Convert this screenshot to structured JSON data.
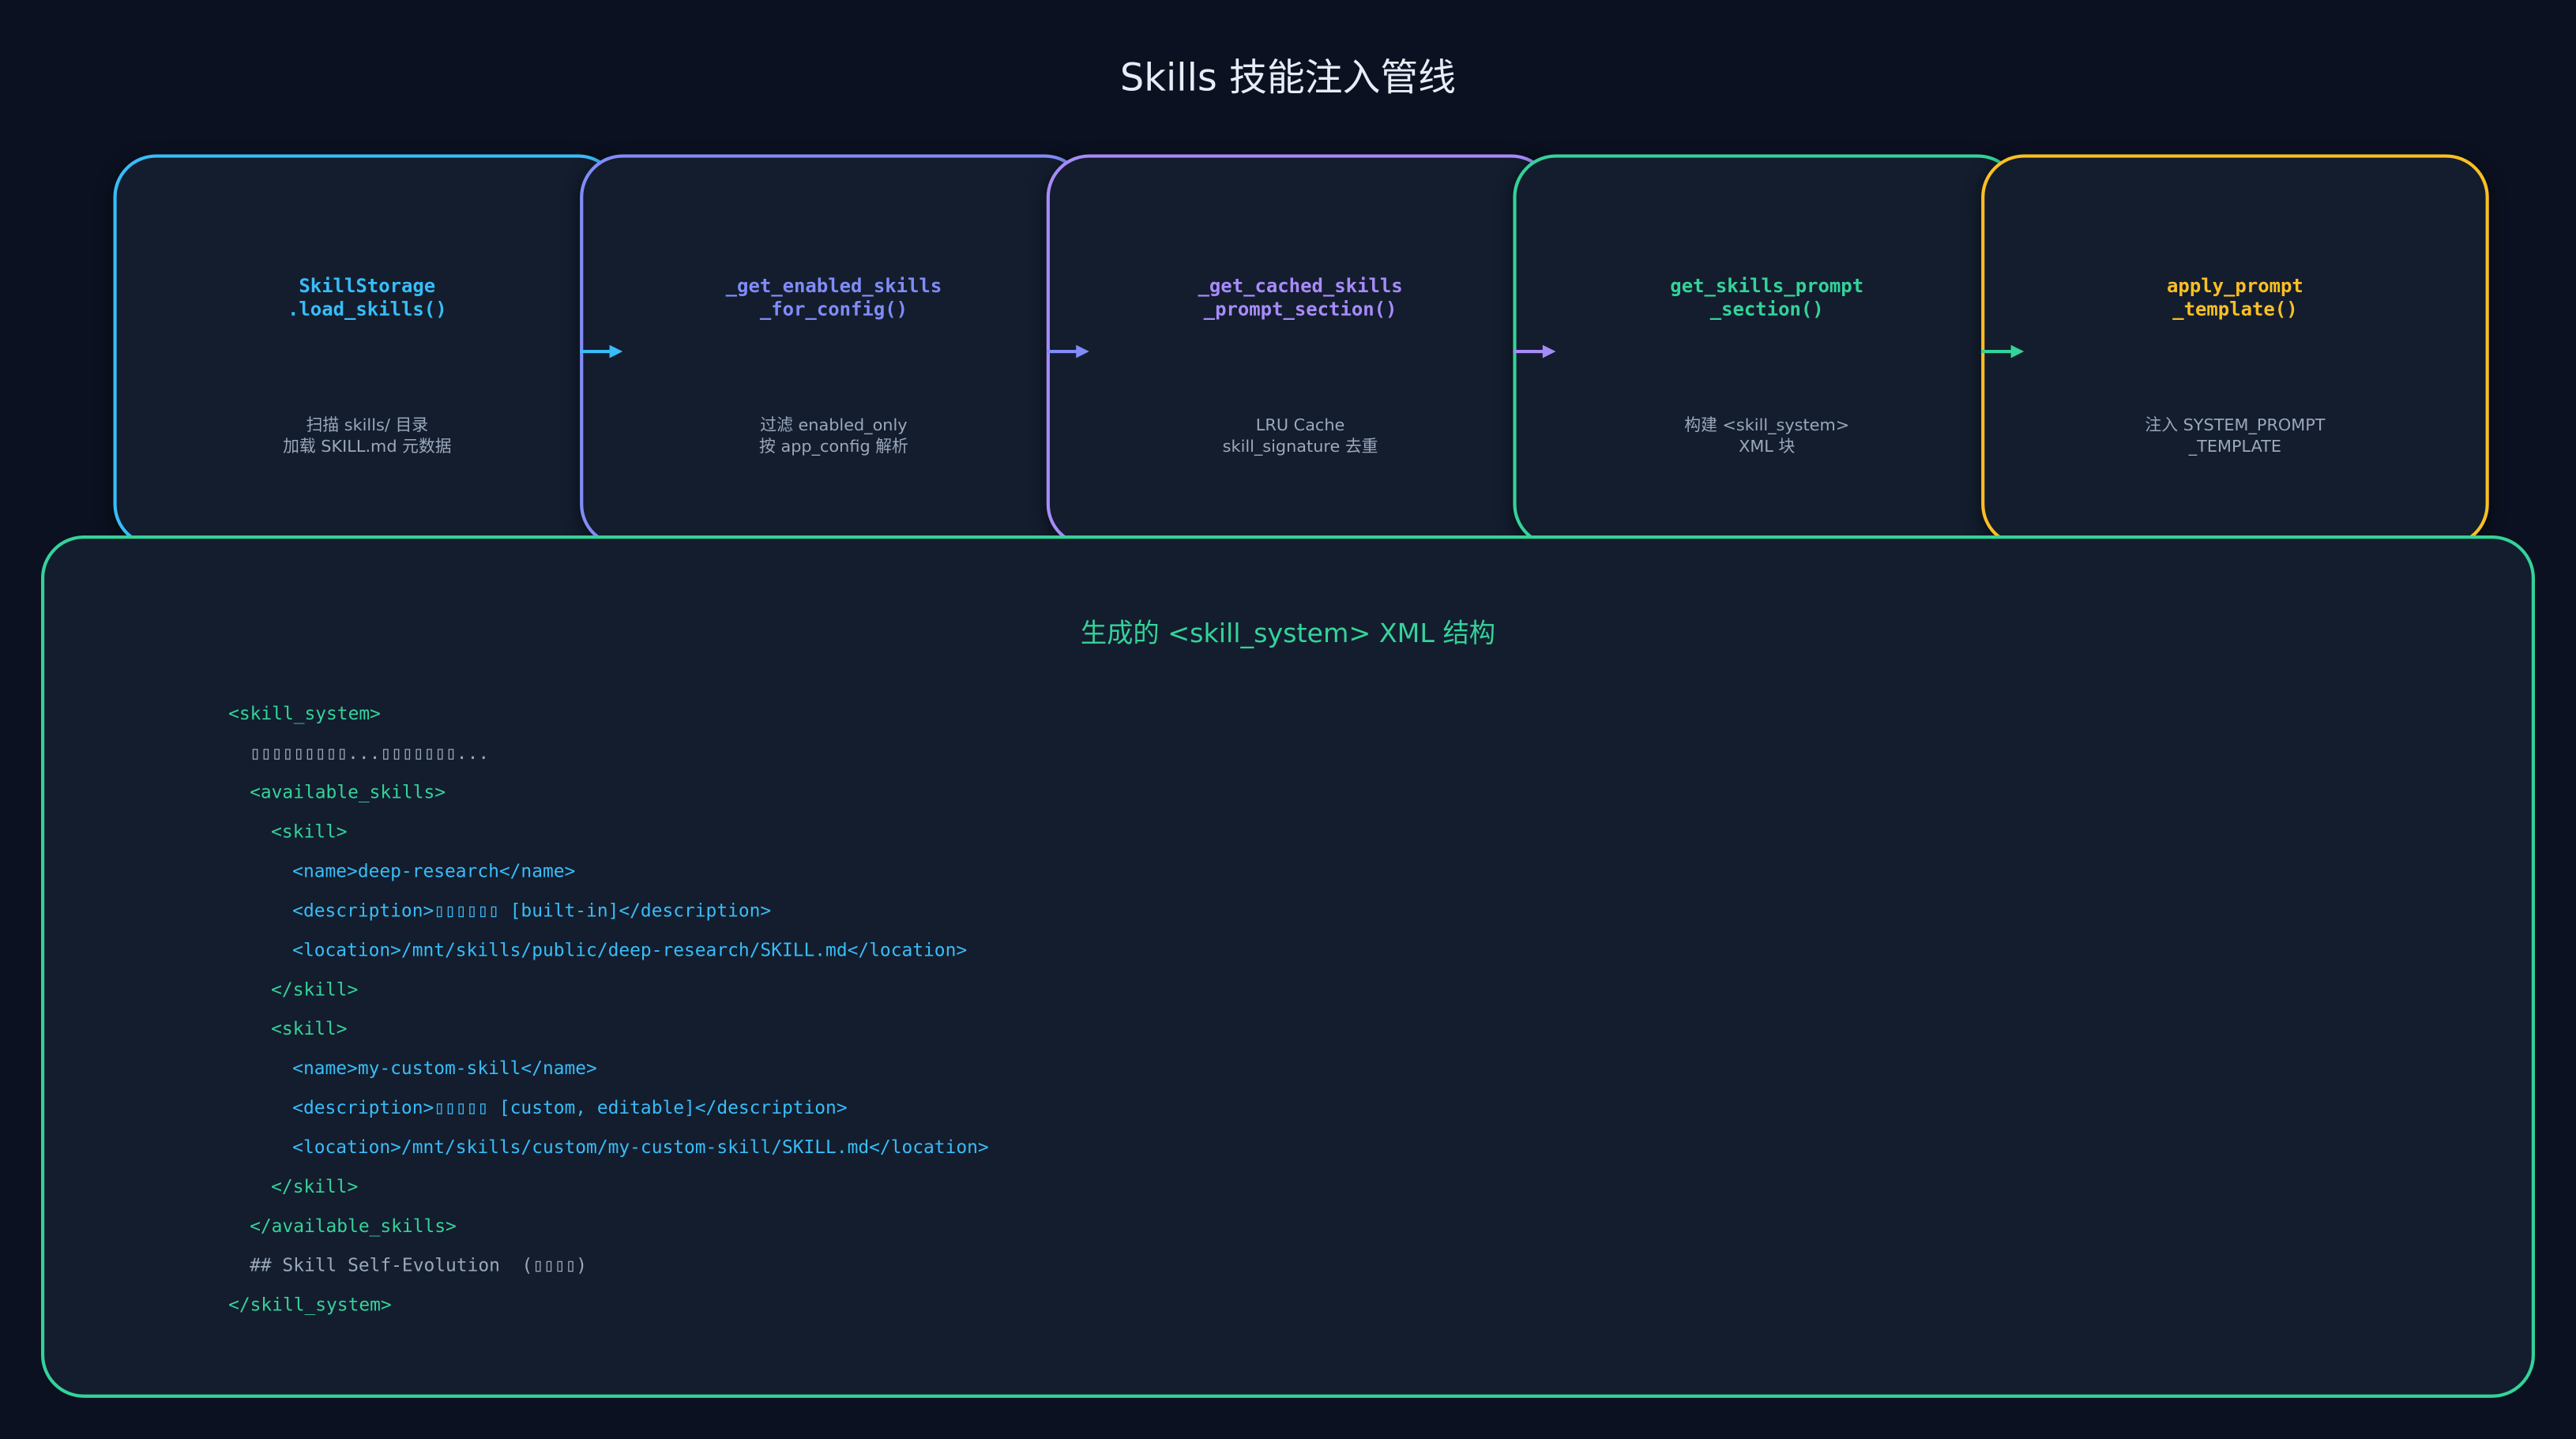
{
  "title": "Skills 技能注入管线",
  "colors": {
    "background": "#0b1120",
    "box_fill": "#131d2e",
    "cyan": "#38bdf8",
    "indigo": "#818cf8",
    "purple": "#a78bfa",
    "green": "#34d399",
    "yellow": "#fbbf24",
    "muted_text": "#9aa8bc"
  },
  "stages": [
    {
      "function_lines": [
        "SkillStorage",
        ".load_skills()"
      ],
      "description_lines": [
        "扫描 skills/ 目录",
        "加载 SKILL.md 元数据"
      ],
      "color": "#38bdf8"
    },
    {
      "function_lines": [
        "_get_enabled_skills",
        "_for_config()"
      ],
      "description_lines": [
        "过滤 enabled_only",
        "按 app_config 解析"
      ],
      "color": "#818cf8"
    },
    {
      "function_lines": [
        "_get_cached_skills",
        "_prompt_section()"
      ],
      "description_lines": [
        "LRU Cache",
        "skill_signature 去重"
      ],
      "color": "#a78bfa"
    },
    {
      "function_lines": [
        "get_skills_prompt",
        "_section()"
      ],
      "description_lines": [
        "构建 <skill_system>",
        "XML 块"
      ],
      "color": "#34d399"
    },
    {
      "function_lines": [
        "apply_prompt",
        "_template()"
      ],
      "description_lines": [
        "注入 SYSTEM_PROMPT",
        "_TEMPLATE"
      ],
      "color": "#fbbf24"
    }
  ],
  "arrows": [
    {
      "color": "#38bdf8"
    },
    {
      "color": "#818cf8"
    },
    {
      "color": "#a78bfa"
    },
    {
      "color": "#34d399"
    }
  ],
  "xml_panel": {
    "title": "生成的 <skill_system> XML 结构",
    "lines": [
      {
        "text": "<skill_system>",
        "indent": 0,
        "color": "#34d399"
      },
      {
        "text": "▯▯▯▯▯▯▯▯▯...▯▯▯▯▯▯▯...",
        "indent": 1,
        "color": "#9aa8bc"
      },
      {
        "text": "<available_skills>",
        "indent": 1,
        "color": "#34d399"
      },
      {
        "text": "<skill>",
        "indent": 2,
        "color": "#34d399"
      },
      {
        "text": "<name>deep-research</name>",
        "indent": 3,
        "color": "#38bdf8"
      },
      {
        "text": "<description>▯▯▯▯▯▯ [built-in]</description>",
        "indent": 3,
        "color": "#38bdf8"
      },
      {
        "text": "<location>/mnt/skills/public/deep-research/SKILL.md</location>",
        "indent": 3,
        "color": "#38bdf8"
      },
      {
        "text": "</skill>",
        "indent": 2,
        "color": "#34d399"
      },
      {
        "text": "<skill>",
        "indent": 2,
        "color": "#34d399"
      },
      {
        "text": "<name>my-custom-skill</name>",
        "indent": 3,
        "color": "#38bdf8"
      },
      {
        "text": "<description>▯▯▯▯▯ [custom, editable]</description>",
        "indent": 3,
        "color": "#38bdf8"
      },
      {
        "text": "<location>/mnt/skills/custom/my-custom-skill/SKILL.md</location>",
        "indent": 3,
        "color": "#38bdf8"
      },
      {
        "text": "</skill>",
        "indent": 2,
        "color": "#34d399"
      },
      {
        "text": "</available_skills>",
        "indent": 1,
        "color": "#34d399"
      },
      {
        "text": "## Skill Self-Evolution  (▯▯▯▯)",
        "indent": 1,
        "color": "#9aa8bc"
      },
      {
        "text": "</skill_system>",
        "indent": 0,
        "color": "#34d399"
      }
    ]
  }
}
